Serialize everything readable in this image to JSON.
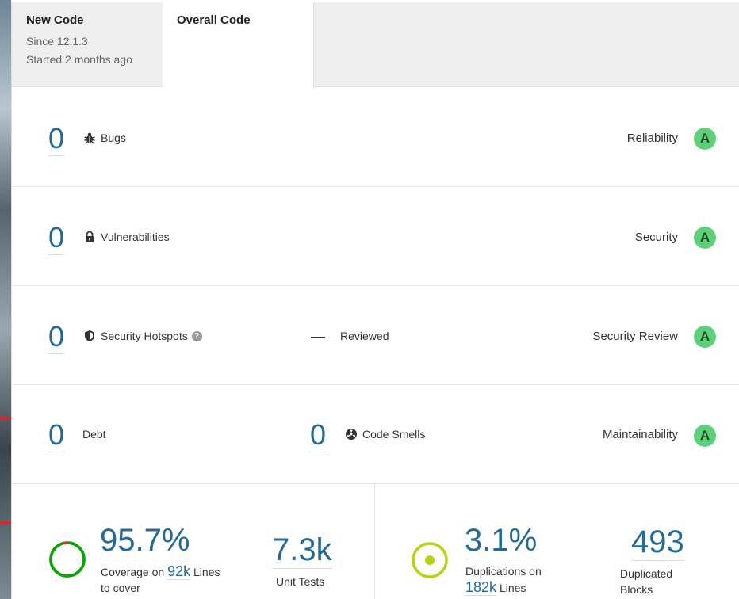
{
  "tabs": {
    "new_code": {
      "title": "New Code",
      "since": "Since 12.1.3",
      "started": "Started 2 months ago"
    },
    "overall_code": {
      "title": "Overall Code"
    }
  },
  "rows": {
    "bugs": {
      "value": "0",
      "label": "Bugs",
      "rating_label": "Reliability",
      "rating": "A"
    },
    "vulnerabilities": {
      "value": "0",
      "label": "Vulnerabilities",
      "rating_label": "Security",
      "rating": "A"
    },
    "hotspots": {
      "value": "0",
      "label": "Security Hotspots",
      "reviewed_value": "—",
      "reviewed_label": "Reviewed",
      "rating_label": "Security Review",
      "rating": "A"
    },
    "maintainability": {
      "debt_value": "0",
      "debt_label": "Debt",
      "smells_value": "0",
      "smells_label": "Code Smells",
      "rating_label": "Maintainability",
      "rating": "A"
    }
  },
  "coverage": {
    "value": "95.7%",
    "label_prefix": "Coverage on",
    "lines_value": "92k",
    "label_suffix": "Lines",
    "label_line2": "to cover",
    "percent": 95.7,
    "unit_tests_value": "7.3k",
    "unit_tests_label": "Unit Tests"
  },
  "duplications": {
    "value": "3.1%",
    "label_prefix": "Duplications on",
    "lines_value": "182k",
    "label_suffix": "Lines",
    "blocks_value": "493",
    "blocks_label_line1": "Duplicated",
    "blocks_label_line2": "Blocks"
  },
  "colors": {
    "accent": "#236a97",
    "rating_a": "#5fd07a",
    "coverage_ring": "#00aa00",
    "coverage_gap": "#d4333f",
    "duplication_ring": "#b0d513"
  }
}
